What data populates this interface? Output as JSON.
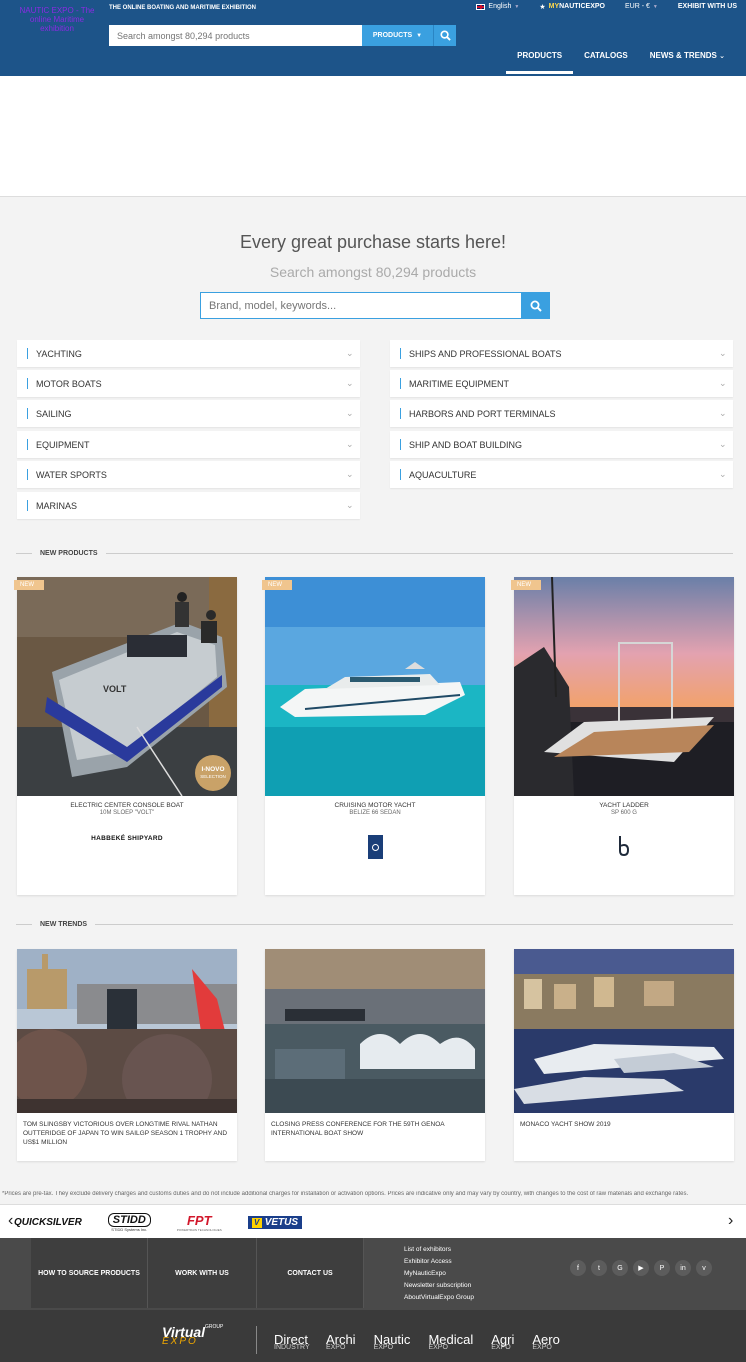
{
  "header": {
    "logo_alt": "NAUTIC EXPO - The online Maritime exhibition",
    "tagline": "THE ONLINE BOATING AND MARITIME EXHIBITION",
    "language": "English",
    "mynautic_prefix": "MY",
    "mynautic_name": "NAUTICEXPO",
    "currency": "EUR - €",
    "exhibit": "EXHIBIT WITH US",
    "search_placeholder": "Search amongst 80,294 products",
    "search_scope": "PRODUCTS",
    "nav": [
      {
        "label": "PRODUCTS",
        "active": true
      },
      {
        "label": "CATALOGS",
        "active": false
      },
      {
        "label": "NEWS & TRENDS",
        "active": false
      }
    ]
  },
  "hero": {
    "title": "Every great purchase starts here!",
    "subtitle": "Search amongst 80,294 products",
    "search_placeholder": "Brand, model, keywords..."
  },
  "categories": {
    "left": [
      "YACHTING",
      "MOTOR BOATS",
      "SAILING",
      "EQUIPMENT",
      "WATER SPORTS",
      "MARINAS"
    ],
    "right": [
      "SHIPS AND PROFESSIONAL BOATS",
      "MARITIME EQUIPMENT",
      "HARBORS AND PORT TERMINALS",
      "SHIP AND BOAT BUILDING",
      "AQUACULTURE"
    ]
  },
  "new_products": {
    "heading": "NEW PRODUCTS",
    "badge": "NEW",
    "items": [
      {
        "title": "ELECTRIC CENTER CONSOLE BOAT",
        "subtitle": "10M SLOEP \"VOLT\"",
        "brand": "HABBEKÉ SHIPYARD",
        "hull_text": "VOLT",
        "award_line1": "I-NOVO",
        "award_line2": "SELECTION"
      },
      {
        "title": "CRUISING MOTOR YACHT",
        "subtitle": "BELIZE 66 SEDAN",
        "brand": ""
      },
      {
        "title": "YACHT LADDER",
        "subtitle": "SP 600 G",
        "brand": ""
      }
    ]
  },
  "new_trends": {
    "heading": "NEW TRENDS",
    "items": [
      {
        "title": "TOM SLINGSBY VICTORIOUS OVER LONGTIME RIVAL NATHAN OUTTERIDGE OF JAPAN TO WIN SAILGP SEASON 1 TROPHY AND US$1 MILLION"
      },
      {
        "title": "CLOSING PRESS CONFERENCE FOR THE 59TH GENOA INTERNATIONAL BOAT SHOW"
      },
      {
        "title": "MONACO YACHT SHOW 2019"
      }
    ]
  },
  "disclaimer": "*Prices are pre-tax. They exclude delivery charges and customs duties and do not include additional charges for installation or activation options. Prices are indicative only and may vary by country, with changes to the cost of raw materials and exchange rates.",
  "brands": [
    "QUICKSILVER",
    "STIDD",
    "FPT",
    "VETUS"
  ],
  "brand_sub": {
    "stidd": "STIDD Systems Inc.",
    "fpt": "POWERTRAIN TECHNOLOGIES"
  },
  "footer": {
    "nav": [
      "HOW TO SOURCE PRODUCTS",
      "WORK WITH US",
      "CONTACT US"
    ],
    "links": [
      "List of exhibitors",
      "Exhibitor Access",
      "MyNauticExpo",
      "Newsletter subscription",
      "AboutVirtualExpo Group"
    ],
    "social": [
      "f",
      "t",
      "G",
      "▶",
      "P",
      "in",
      "v"
    ],
    "group_name": "Virtual",
    "group_suffix": "GROUP",
    "group_expo": "EXPO",
    "expos": [
      {
        "name": "Direct",
        "sub": "INDUSTRY"
      },
      {
        "name": "Archi",
        "sub": "EXPO"
      },
      {
        "name": "Nautic",
        "sub": "EXPO"
      },
      {
        "name": "Medical",
        "sub": "EXPO"
      },
      {
        "name": "Agri",
        "sub": "EXPO"
      },
      {
        "name": "Aero",
        "sub": "EXPO"
      }
    ]
  }
}
